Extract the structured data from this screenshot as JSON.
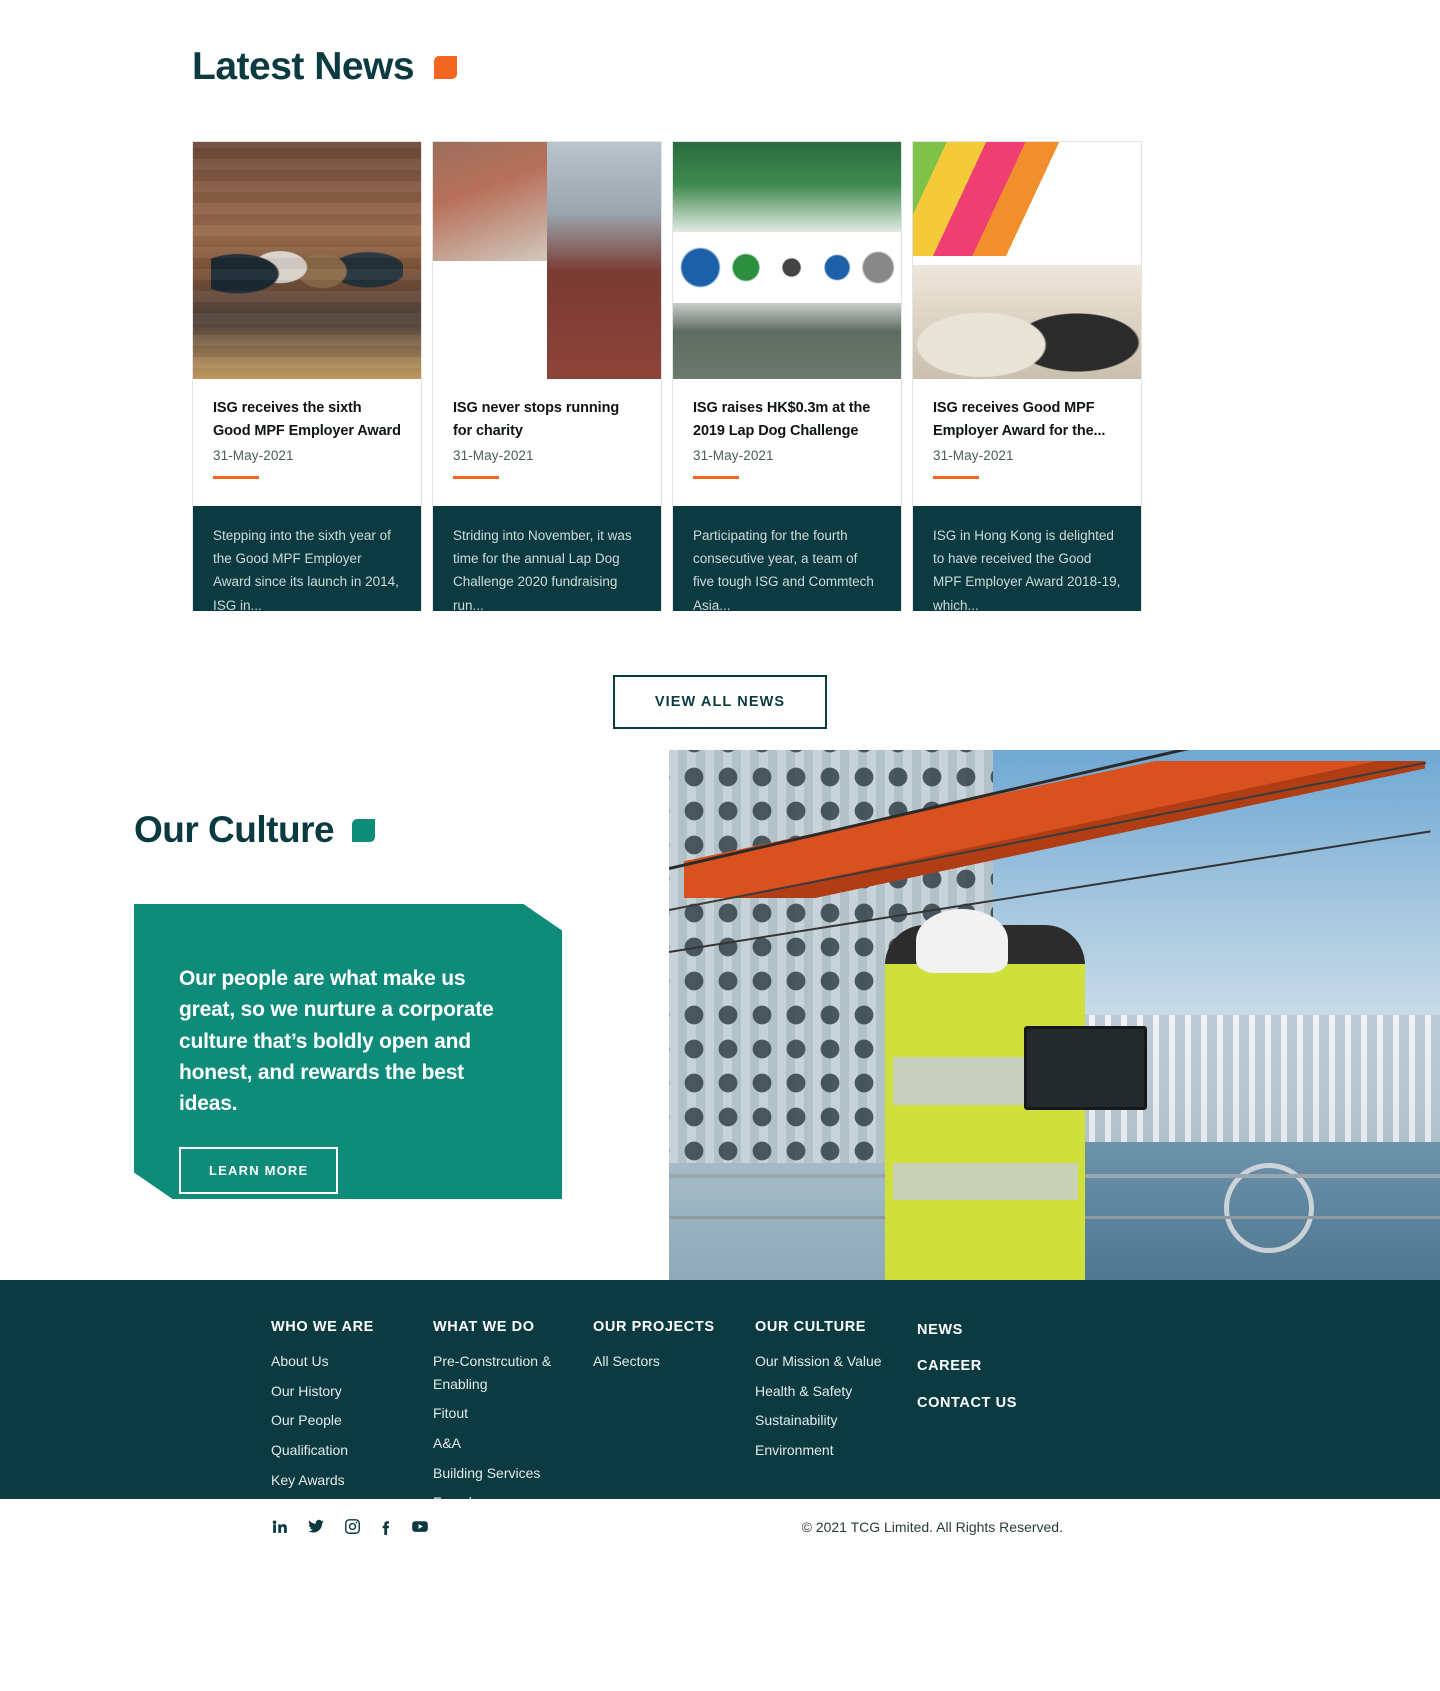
{
  "news": {
    "title": "Latest News",
    "accent_color": "#F26522",
    "view_all_label": "VIEW ALL NEWS",
    "cards": [
      {
        "title": "ISG receives the sixth Good MPF Employer Award",
        "date": "31-May-2021",
        "excerpt": "Stepping into the sixth year of the Good MPF Employer Award since its launch in 2014, ISG in...",
        "image_name": "award-ceremony-group-photo"
      },
      {
        "title": "ISG never stops running for charity",
        "date": "31-May-2021",
        "excerpt": "Striding into November, it was time for the annual Lap Dog Challenge 2020 fundraising run...",
        "image_name": "charity-runners-collage"
      },
      {
        "title": "ISG raises HK$0.3m at the 2019 Lap Dog Challenge",
        "date": "31-May-2021",
        "excerpt": "Participating for the fourth consecutive year, a team of five tough ISG and Commtech Asia...",
        "image_name": "lap-dog-challenge-team"
      },
      {
        "title": "ISG receives Good MPF Employer Award for the...",
        "date": "31-May-2021",
        "excerpt": "ISG in Hong Kong is delighted to have received the Good MPF Employer Award 2018-19, which...",
        "image_name": "good-mpf-employer-award-stage"
      }
    ]
  },
  "culture": {
    "title": "Our Culture",
    "accent_color": "#0E8C79",
    "statement": "Our people are what make us great, so we nurture a corporate culture that’s boldly open and honest, and rewards the best ideas.",
    "learn_more_label": "LEARN MORE",
    "photo_name": "site-engineer-with-tablet-hong-kong-harbour"
  },
  "footer": {
    "columns": [
      {
        "heading": "WHO WE ARE",
        "links": [
          "About Us",
          "Our History",
          "Our People",
          "Qualification",
          "Key Awards"
        ]
      },
      {
        "heading": "WHAT WE DO",
        "links": [
          "Pre-Constrcution & Enabling",
          "Fitout",
          "A&A",
          "Building Services",
          "Facade"
        ]
      },
      {
        "heading": "OUR PROJECTS",
        "links": [
          "All Sectors"
        ]
      },
      {
        "heading": "OUR CULTURE",
        "links": [
          "Our Mission & Value",
          "Health & Safety",
          "Sustainability",
          "Environment"
        ]
      },
      {
        "heading": "",
        "links": [
          "NEWS",
          "CAREER",
          "CONTACT US"
        ]
      }
    ],
    "socials": [
      "linkedin-icon",
      "twitter-icon",
      "instagram-icon",
      "facebook-icon",
      "youtube-icon"
    ],
    "copyright": "© 2021 TCG Limited. All Rights Reserved."
  }
}
